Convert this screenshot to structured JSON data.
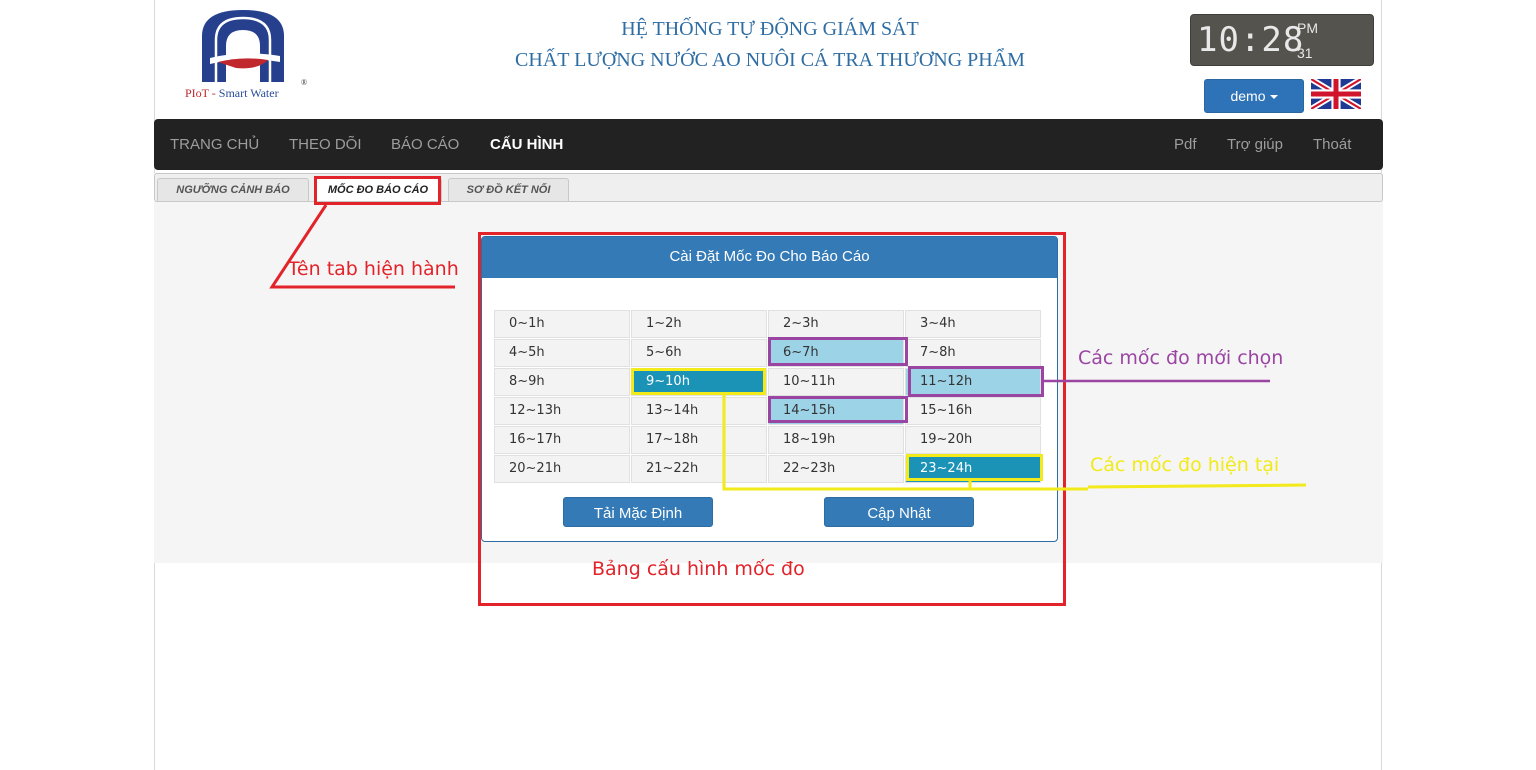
{
  "header": {
    "logo_text_a": "PIoT -",
    "logo_text_b": "Smart Water",
    "logo_mark": "®",
    "title_line1": "HỆ THỐNG TỰ ĐỘNG GIÁM SÁT",
    "title_line2": "CHẤT LƯỢNG NƯỚC AO NUÔI CÁ TRA THƯƠNG PHẨM",
    "clock": {
      "time": "10:28",
      "ampm": "PM",
      "date": "31"
    },
    "user_menu_label": "demo",
    "language_flag": "uk-flag-icon"
  },
  "nav": {
    "left": [
      "TRANG CHỦ",
      "THEO DÕI",
      "BÁO CÁO",
      "CẤU HÌNH"
    ],
    "active": "CẤU HÌNH",
    "right": [
      "Pdf",
      "Trợ giúp",
      "Thoát"
    ]
  },
  "tabs": [
    "NGƯỠNG CẢNH BÁO",
    "MỐC ĐO BÁO CÁO",
    "SƠ ĐỒ KẾT NỐI"
  ],
  "active_tab": "MỐC ĐO BÁO CÁO",
  "panel": {
    "title": "Cài Đặt Mốc Đo Cho Báo Cáo",
    "slots": [
      [
        "0~1h",
        "1~2h",
        "2~3h",
        "3~4h"
      ],
      [
        "4~5h",
        "5~6h",
        "6~7h",
        "7~8h"
      ],
      [
        "8~9h",
        "9~10h",
        "10~11h",
        "11~12h"
      ],
      [
        "12~13h",
        "13~14h",
        "14~15h",
        "15~16h"
      ],
      [
        "16~17h",
        "17~18h",
        "18~19h",
        "19~20h"
      ],
      [
        "20~21h",
        "21~22h",
        "22~23h",
        "23~24h"
      ]
    ],
    "selected_new": [
      "6~7h",
      "11~12h",
      "14~15h"
    ],
    "current": [
      "9~10h",
      "23~24h"
    ],
    "default_button": "Tải Mặc Định",
    "update_button": "Cập Nhật"
  },
  "annotations": {
    "current_tab": "Tên tab hiện hành",
    "new_selection": "Các mốc đo mới chọn",
    "current_selection": "Các mốc đo hiện tại",
    "config_table": "Bảng cấu hình mốc đo"
  },
  "colors": {
    "nav_bg": "#222222",
    "primary": "#337ab7",
    "selected_cell": "#9cd3e6",
    "current_cell": "#1a93b7",
    "annotation_red": "#e2232a",
    "annotation_purple": "#9b45a3",
    "annotation_yellow": "#f2ea1a"
  }
}
